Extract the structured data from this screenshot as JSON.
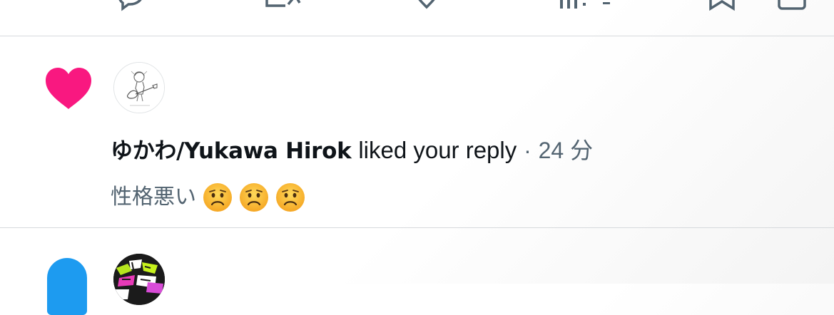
{
  "top_actions": {
    "icons": [
      "reply-icon",
      "retweet-icon",
      "like-icon",
      "views-icon",
      "bookmark-icon",
      "share-icon"
    ]
  },
  "notification": {
    "type_icon": "heart-icon",
    "type_color": "#f91880",
    "actor_name": "ゆかわ/Yukawa Hirok",
    "action_text": "liked your reply",
    "separator": "·",
    "time_ago": "24 分",
    "reply_text": "性格悪い",
    "reply_emojis": [
      "worried-face-emoji",
      "worried-face-emoji",
      "worried-face-emoji"
    ]
  },
  "next_notification": {
    "type_icon": "person-icon",
    "type_color": "#1d9bf0"
  },
  "colors": {
    "text_primary": "#0f1419",
    "text_secondary": "#536471",
    "divider": "#d6d9dc",
    "accent": "#1d9bf0"
  }
}
